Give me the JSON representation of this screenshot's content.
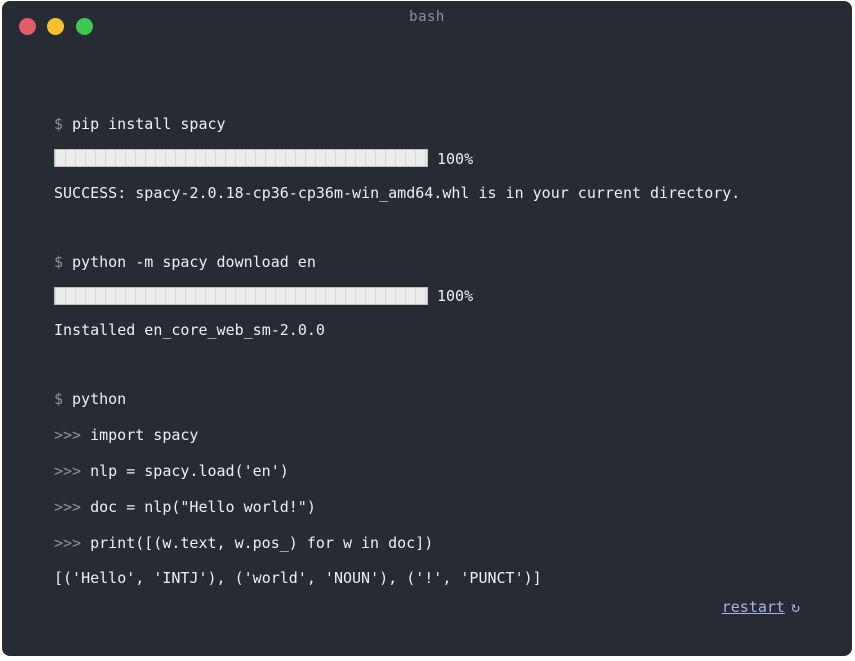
{
  "window": {
    "title": "bash",
    "controls": {
      "close_color": "#e25c6b",
      "minimize_color": "#f5c22d",
      "maximize_color": "#3fc94e"
    }
  },
  "prompt_shell": "$",
  "prompt_python": ">>>",
  "lines": {
    "cmd1": "pip install spacy",
    "progress1_percent": "100%",
    "progress1_value": 1.0,
    "out1": "SUCCESS: spacy-2.0.18-cp36-cp36m-win_amd64.whl is in your current directory.",
    "cmd2": "python -m spacy download en",
    "progress2_percent": "100%",
    "progress2_value": 1.0,
    "out2": "Installed en_core_web_sm-2.0.0",
    "cmd3": "python",
    "py1": "import spacy",
    "py2": "nlp = spacy.load('en')",
    "py3": "doc = nlp(\"Hello world!\")",
    "py4": "print([(w.text, w.pos_) for w in doc])",
    "out3": "[('Hello', 'INTJ'), ('world', 'NOUN'), ('!', 'PUNCT')]"
  },
  "restart": {
    "label": "restart",
    "icon": "refresh-icon",
    "glyph": "↻"
  }
}
